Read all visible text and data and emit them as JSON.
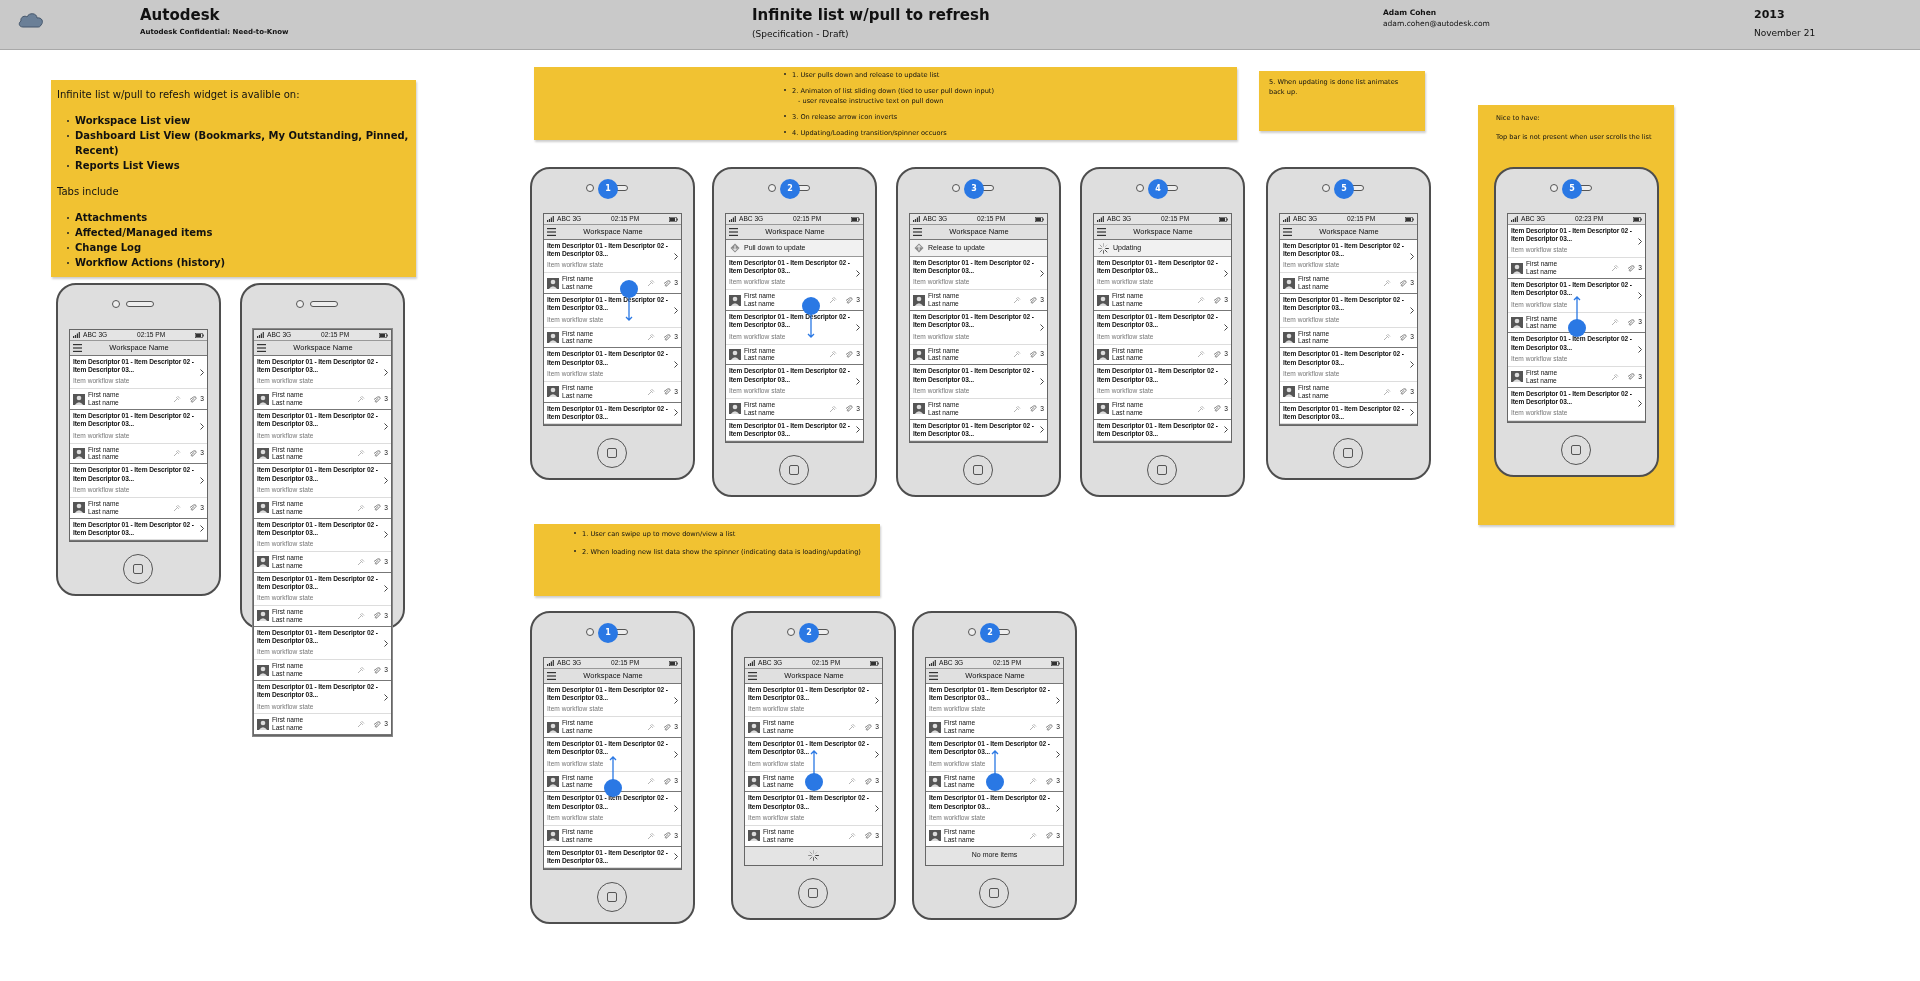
{
  "header": {
    "brand": "Autodesk",
    "confidential": "Autodesk Confidential: Need-to-Know",
    "title": "Infinite list w/pull to refresh",
    "subtitle": "(Specification - Draft)",
    "author": "Adam Cohen",
    "email": "adam.cohen@autodesk.com",
    "year": "2013",
    "date": "November 21"
  },
  "notes": [
    {
      "blocks": [
        {
          "kind": "text",
          "text": "Infinite list w/pull to refesh widget is avalible on:"
        },
        {
          "kind": "list",
          "bold": true,
          "items": [
            {
              "text": "Workspace List view"
            },
            {
              "text": "Dashboard List View (Bookmarks, My Outstanding, Pinned, Recent)"
            },
            {
              "text": "Reports List Views"
            }
          ]
        },
        {
          "kind": "text",
          "text": "Tabs include"
        },
        {
          "kind": "list",
          "bold": true,
          "items": [
            {
              "text": "Attachments"
            },
            {
              "text": "Affected/Managed items"
            },
            {
              "text": "Change Log"
            },
            {
              "text": "Workflow Actions (history)"
            }
          ]
        }
      ]
    },
    {
      "blocks": [
        {
          "kind": "list",
          "bold": false,
          "items": [
            {
              "text": "1. User pulls down and release to update list"
            },
            {
              "text": "2. Animaton of list sliding down (tied to user pull down input)",
              "sub": "- user revealse instructive text on pull down"
            },
            {
              "text": "3. On release arrow icon inverts"
            },
            {
              "text": "4. Updating/Loading transition/spinner occuors"
            }
          ]
        }
      ]
    },
    {
      "blocks": [
        {
          "kind": "text",
          "text": "5. When updating is done list animates back up."
        }
      ]
    },
    {
      "blocks": [
        {
          "kind": "text",
          "text": "Nice to have:"
        },
        {
          "kind": "text",
          "text": "Top bar is not present when user scrolls the list"
        }
      ]
    },
    {
      "blocks": [
        {
          "kind": "list",
          "bold": false,
          "items": [
            {
              "text": "1. User can swipe up to move down/view a list"
            },
            {
              "text": "2. When loading new list data show the spinner (indicating data is loading/updating)"
            }
          ]
        }
      ]
    }
  ],
  "phones": [
    {
      "status": {
        "carrier": "ABC 3G",
        "time": "02:15 PM"
      },
      "title": "Workspace Name",
      "items": [
        {
          "title": "Item Descriptor 01 - Item Descriptor 02 - Item Descriptor 03...",
          "state": "Item workflow state",
          "first": "First name",
          "last": "Last name",
          "count": "3"
        },
        {
          "title": "Item Descriptor 01 - Item Descriptor 02 - Item Descriptor 03...",
          "state": "Item workflow state",
          "first": "First name",
          "last": "Last name",
          "count": "3"
        },
        {
          "title": "Item Descriptor 01 - Item Descriptor 02 - Item Descriptor 03...",
          "state": "Item workflow state",
          "first": "First name",
          "last": "Last name",
          "count": "3"
        },
        {
          "title": "Item Descriptor 01 - Item Descriptor 02 - Item Descriptor 03..."
        }
      ]
    },
    {
      "overflow": true,
      "status": {
        "carrier": "ABC 3G",
        "time": "02:15 PM"
      },
      "title": "Workspace Name",
      "items": [
        {
          "title": "Item Descriptor 01 - Item Descriptor 02 - Item Descriptor 03...",
          "state": "Item workflow state",
          "first": "First name",
          "last": "Last name",
          "count": "3"
        },
        {
          "title": "Item Descriptor 01 - Item Descriptor 02 - Item Descriptor 03...",
          "state": "Item workflow state",
          "first": "First name",
          "last": "Last name",
          "count": "3"
        },
        {
          "title": "Item Descriptor 01 - Item Descriptor 02 - Item Descriptor 03...",
          "state": "Item workflow state",
          "first": "First name",
          "last": "Last name",
          "count": "3"
        },
        {
          "title": "Item Descriptor 01 - Item Descriptor 02 - Item Descriptor 03...",
          "state": "Item workflow state",
          "first": "First name",
          "last": "Last name",
          "count": "3"
        },
        {
          "title": "Item Descriptor 01 - Item Descriptor 02 - Item Descriptor 03...",
          "state": "Item workflow state",
          "first": "First name",
          "last": "Last name",
          "count": "3"
        },
        {
          "title": "Item Descriptor 01 - Item Descriptor 02 - Item Descriptor 03...",
          "state": "Item workflow state",
          "first": "First name",
          "last": "Last name",
          "count": "3"
        },
        {
          "title": "Item Descriptor 01 - Item Descriptor 02 - Item Descriptor 03...",
          "state": "Item workflow state",
          "first": "First name",
          "last": "Last name",
          "count": "3"
        }
      ]
    },
    {
      "badge": "1",
      "gesture": {
        "kind": "down"
      },
      "status": {
        "carrier": "ABC 3G",
        "time": "02:15 PM"
      },
      "title": "Workspace Name",
      "items": [
        {
          "title": "Item Descriptor 01 - Item Descriptor 02 - Item Descriptor 03...",
          "state": "Item workflow state",
          "first": "First name",
          "last": "Last name",
          "count": "3"
        },
        {
          "title": "Item Descriptor 01 - Item Descriptor 02 - Item Descriptor 03...",
          "state": "Item workflow state",
          "first": "First name",
          "last": "Last name",
          "count": "3"
        },
        {
          "title": "Item Descriptor 01 - Item Descriptor 02 - Item Descriptor 03...",
          "state": "Item workflow state",
          "first": "First name",
          "last": "Last name",
          "count": "3"
        },
        {
          "title": "Item Descriptor 01 - Item Descriptor 02 - Item Descriptor 03..."
        }
      ]
    },
    {
      "badge": "2",
      "gesture": {
        "kind": "down"
      },
      "status": {
        "carrier": "ABC 3G",
        "time": "02:15 PM"
      },
      "title": "Workspace Name",
      "top": {
        "kind": "pull",
        "text": "Pull down to update"
      },
      "items": [
        {
          "title": "Item Descriptor 01 - Item Descriptor 02 - Item Descriptor 03...",
          "state": "Item workflow state",
          "first": "First name",
          "last": "Last name",
          "count": "3"
        },
        {
          "title": "Item Descriptor 01 - Item Descriptor 02 - Item Descriptor 03...",
          "state": "Item workflow state",
          "first": "First name",
          "last": "Last name",
          "count": "3"
        },
        {
          "title": "Item Descriptor 01 - Item Descriptor 02 - Item Descriptor 03...",
          "state": "Item workflow state",
          "first": "First name",
          "last": "Last name",
          "count": "3"
        },
        {
          "title": "Item Descriptor 01 - Item Descriptor 02 - Item Descriptor 03..."
        }
      ]
    },
    {
      "badge": "3",
      "status": {
        "carrier": "ABC 3G",
        "time": "02:15 PM"
      },
      "title": "Workspace Name",
      "top": {
        "kind": "release",
        "text": "Release to update"
      },
      "items": [
        {
          "title": "Item Descriptor 01 - Item Descriptor 02 - Item Descriptor 03...",
          "state": "Item workflow state",
          "first": "First name",
          "last": "Last name",
          "count": "3"
        },
        {
          "title": "Item Descriptor 01 - Item Descriptor 02 - Item Descriptor 03...",
          "state": "Item workflow state",
          "first": "First name",
          "last": "Last name",
          "count": "3"
        },
        {
          "title": "Item Descriptor 01 - Item Descriptor 02 - Item Descriptor 03...",
          "state": "Item workflow state",
          "first": "First name",
          "last": "Last name",
          "count": "3"
        },
        {
          "title": "Item Descriptor 01 - Item Descriptor 02 - Item Descriptor 03..."
        }
      ]
    },
    {
      "badge": "4",
      "status": {
        "carrier": "ABC 3G",
        "time": "02:15 PM"
      },
      "title": "Workspace Name",
      "top": {
        "kind": "updating",
        "text": "Updating"
      },
      "items": [
        {
          "title": "Item Descriptor 01 - Item Descriptor 02 - Item Descriptor 03...",
          "state": "Item workflow state",
          "first": "First name",
          "last": "Last name",
          "count": "3"
        },
        {
          "title": "Item Descriptor 01 - Item Descriptor 02 - Item Descriptor 03...",
          "state": "Item workflow state",
          "first": "First name",
          "last": "Last name",
          "count": "3"
        },
        {
          "title": "Item Descriptor 01 - Item Descriptor 02 - Item Descriptor 03...",
          "state": "Item workflow state",
          "first": "First name",
          "last": "Last name",
          "count": "3"
        },
        {
          "title": "Item Descriptor 01 - Item Descriptor 02 - Item Descriptor 03..."
        }
      ]
    },
    {
      "badge": "5",
      "status": {
        "carrier": "ABC 3G",
        "time": "02:15 PM"
      },
      "title": "Workspace Name",
      "items": [
        {
          "title": "Item Descriptor 01 - Item Descriptor 02 - Item Descriptor 03...",
          "state": "Item workflow state",
          "first": "First name",
          "last": "Last name",
          "count": "3"
        },
        {
          "title": "Item Descriptor 01 - Item Descriptor 02 - Item Descriptor 03...",
          "state": "Item workflow state",
          "first": "First name",
          "last": "Last name",
          "count": "3"
        },
        {
          "title": "Item Descriptor 01 - Item Descriptor 02 - Item Descriptor 03...",
          "state": "Item workflow state",
          "first": "First name",
          "last": "Last name",
          "count": "3"
        },
        {
          "title": "Item Descriptor 01 - Item Descriptor 02 - Item Descriptor 03..."
        }
      ]
    },
    {
      "badge": "5",
      "gesture": {
        "kind": "up"
      },
      "status": {
        "carrier": "ABC 3G",
        "time": "02:23 PM"
      },
      "items": [
        {
          "title": "Item Descriptor 01 - Item Descriptor 02 - Item Descriptor 03...",
          "state": "Item workflow state",
          "first": "First name",
          "last": "Last name",
          "count": "3"
        },
        {
          "title": "Item Descriptor 01 - Item Descriptor 02 - Item Descriptor 03...",
          "state": "Item workflow state",
          "first": "First name",
          "last": "Last name",
          "count": "3"
        },
        {
          "title": "Item Descriptor 01 - Item Descriptor 02 - Item Descriptor 03...",
          "state": "Item workflow state",
          "first": "First name",
          "last": "Last name",
          "count": "3"
        },
        {
          "title": "Item Descriptor 01 - Item Descriptor 02 - Item Descriptor 03...",
          "state": "Item workflow state"
        }
      ]
    },
    {
      "badge": "1",
      "gesture": {
        "kind": "up"
      },
      "status": {
        "carrier": "ABC 3G",
        "time": "02:15 PM"
      },
      "title": "Workspace Name",
      "items": [
        {
          "title": "Item Descriptor 01 - Item Descriptor 02 - Item Descriptor 03...",
          "state": "Item workflow state",
          "first": "First name",
          "last": "Last name",
          "count": "3"
        },
        {
          "title": "Item Descriptor 01 - Item Descriptor 02 - Item Descriptor 03...",
          "state": "Item workflow state",
          "first": "First name",
          "last": "Last name",
          "count": "3"
        },
        {
          "title": "Item Descriptor 01 - Item Descriptor 02 - Item Descriptor 03...",
          "state": "Item workflow state",
          "first": "First name",
          "last": "Last name",
          "count": "3"
        },
        {
          "title": "Item Descriptor 01 - Item Descriptor 02 - Item Descriptor 03..."
        }
      ]
    },
    {
      "badge": "2",
      "gesture": {
        "kind": "up"
      },
      "status": {
        "carrier": "ABC 3G",
        "time": "02:15 PM"
      },
      "title": "Workspace Name",
      "items": [
        {
          "title": "Item Descriptor 01 - Item Descriptor 02 - Item Descriptor 03...",
          "state": "Item workflow state",
          "first": "First name",
          "last": "Last name",
          "count": "3"
        },
        {
          "title": "Item Descriptor 01 - Item Descriptor 02 - Item Descriptor 03...",
          "state": "Item workflow state",
          "first": "First name",
          "last": "Last name",
          "count": "3"
        },
        {
          "title": "Item Descriptor 01 - Item Descriptor 02 - Item Descriptor 03...",
          "state": "Item workflow state",
          "first": "First name",
          "last": "Last name",
          "count": "3"
        }
      ],
      "bottom": {
        "kind": "spinner"
      }
    },
    {
      "badge": "2",
      "gesture": {
        "kind": "up"
      },
      "status": {
        "carrier": "ABC 3G",
        "time": "02:15 PM"
      },
      "title": "Workspace Name",
      "items": [
        {
          "title": "Item Descriptor 01 - Item Descriptor 02 - Item Descriptor 03...",
          "state": "Item workflow state",
          "first": "First name",
          "last": "Last name",
          "count": "3"
        },
        {
          "title": "Item Descriptor 01 - Item Descriptor 02 - Item Descriptor 03...",
          "state": "Item workflow state",
          "first": "First name",
          "last": "Last name",
          "count": "3"
        },
        {
          "title": "Item Descriptor 01 - Item Descriptor 02 - Item Descriptor 03...",
          "state": "Item workflow state",
          "first": "First name",
          "last": "Last name",
          "count": "3"
        }
      ],
      "bottom": {
        "kind": "end",
        "text": "No more items"
      }
    }
  ]
}
